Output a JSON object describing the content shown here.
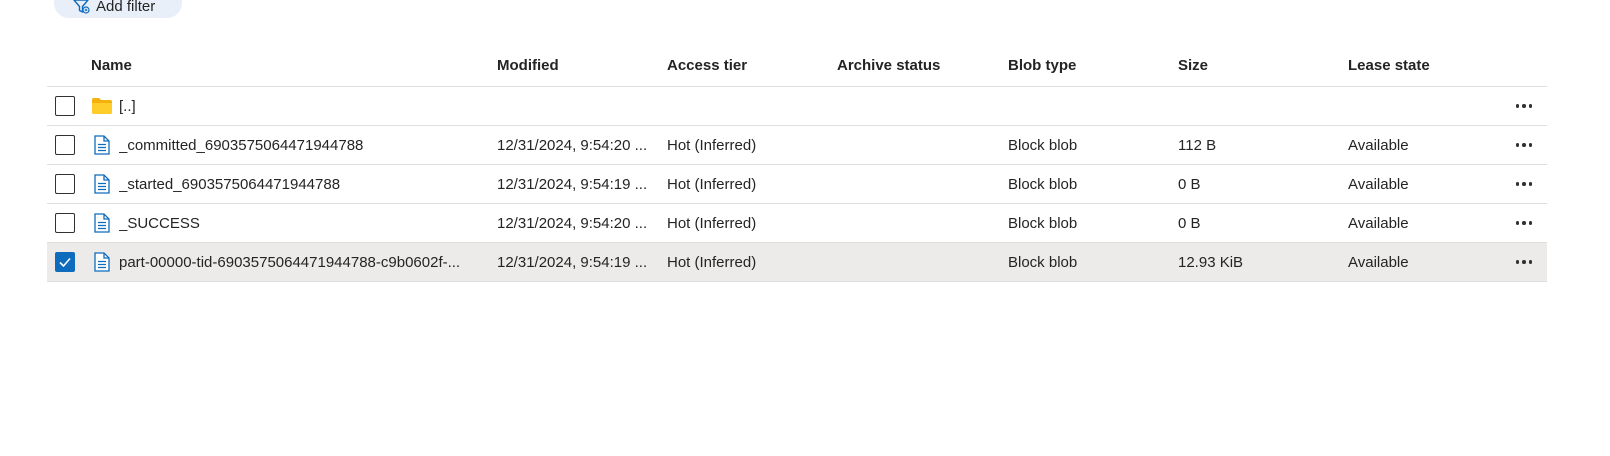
{
  "toolbar": {
    "add_filter_label": "Add filter"
  },
  "columns": {
    "name": "Name",
    "modified": "Modified",
    "access_tier": "Access tier",
    "archive_status": "Archive status",
    "blob_type": "Blob type",
    "size": "Size",
    "lease_state": "Lease state"
  },
  "rows": [
    {
      "name": "[..]",
      "modified": "",
      "access_tier": "",
      "archive_status": "",
      "blob_type": "",
      "size": "",
      "lease_state": "",
      "icon": "folder-icon",
      "checked": false
    },
    {
      "name": "_committed_6903575064471944788",
      "modified": "12/31/2024, 9:54:20 ...",
      "access_tier": "Hot (Inferred)",
      "archive_status": "",
      "blob_type": "Block blob",
      "size": "112 B",
      "lease_state": "Available",
      "icon": "file-icon",
      "checked": false
    },
    {
      "name": "_started_6903575064471944788",
      "modified": "12/31/2024, 9:54:19 ...",
      "access_tier": "Hot (Inferred)",
      "archive_status": "",
      "blob_type": "Block blob",
      "size": "0 B",
      "lease_state": "Available",
      "icon": "file-icon",
      "checked": false
    },
    {
      "name": "_SUCCESS",
      "modified": "12/31/2024, 9:54:20 ...",
      "access_tier": "Hot (Inferred)",
      "archive_status": "",
      "blob_type": "Block blob",
      "size": "0 B",
      "lease_state": "Available",
      "icon": "file-icon",
      "checked": false
    },
    {
      "name": "part-00000-tid-6903575064471944788-c9b0602f-...",
      "modified": "12/31/2024, 9:54:19 ...",
      "access_tier": "Hot (Inferred)",
      "archive_status": "",
      "blob_type": "Block blob",
      "size": "12.93 KiB",
      "lease_state": "Available",
      "icon": "file-icon",
      "checked": true
    }
  ],
  "colors": {
    "accent": "#0f6cbd",
    "folder": "#f3b00f",
    "selected_row": "#edebe9",
    "pill": "#e8eff8"
  }
}
